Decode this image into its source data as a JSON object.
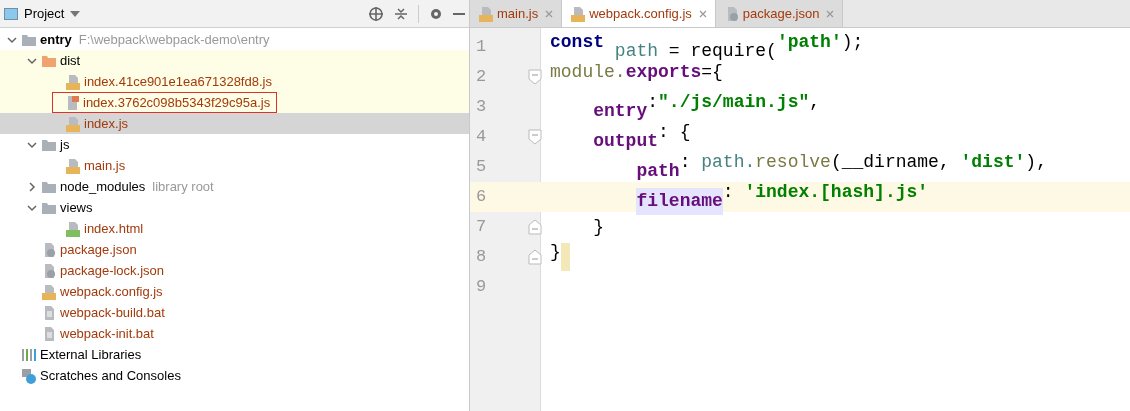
{
  "project_panel": {
    "title": "Project",
    "tree": [
      {
        "label": "entry",
        "hint": "F:\\webpack\\webpack-demo\\entry",
        "kind": "folder",
        "bold": true,
        "expanded": true,
        "selected": false,
        "children": [
          {
            "label": "dist",
            "kind": "excluded-folder",
            "expanded": true,
            "selected": false,
            "marked": true,
            "children": [
              {
                "label": "index.41ce901e1ea671328fd8.js",
                "kind": "js",
                "selected": false,
                "marked": true,
                "boxed": false
              },
              {
                "label": "index.3762c098b5343f29c95a.js",
                "kind": "binary",
                "selected": false,
                "marked": true,
                "boxed": true
              },
              {
                "label": "index.js",
                "kind": "js",
                "selected": true,
                "marked": true,
                "boxed": false
              }
            ]
          },
          {
            "label": "js",
            "kind": "folder",
            "expanded": true,
            "selected": false,
            "children": [
              {
                "label": "main.js",
                "kind": "js",
                "selected": false
              }
            ]
          },
          {
            "label": "node_modules",
            "hint": "library root",
            "kind": "folder",
            "expanded": false,
            "selected": false
          },
          {
            "label": "views",
            "kind": "folder",
            "expanded": true,
            "selected": false,
            "children": [
              {
                "label": "index.html",
                "kind": "html",
                "selected": false
              }
            ]
          },
          {
            "label": "package.json",
            "kind": "json",
            "selected": false
          },
          {
            "label": "package-lock.json",
            "kind": "json",
            "selected": false
          },
          {
            "label": "webpack.config.js",
            "kind": "js",
            "selected": false
          },
          {
            "label": "webpack-build.bat",
            "kind": "text",
            "selected": false
          },
          {
            "label": "webpack-init.bat",
            "kind": "text",
            "selected": false
          }
        ]
      },
      {
        "label": "External Libraries",
        "kind": "libraries",
        "selected": false
      },
      {
        "label": "Scratches and Consoles",
        "kind": "scratches",
        "selected": false
      }
    ]
  },
  "editor": {
    "tabs": [
      {
        "label": "main.js",
        "kind": "js",
        "selected": false
      },
      {
        "label": "webpack.config.js",
        "kind": "js",
        "selected": true
      },
      {
        "label": "package.json",
        "kind": "json",
        "selected": false
      }
    ],
    "lines": [
      {
        "number": "1",
        "current": false,
        "tokens": [
          {
            "kind": "keyword",
            "text": "const"
          },
          {
            "kind": "variable",
            "text": " path"
          },
          {
            "kind": "plain",
            "text": " = require("
          },
          {
            "kind": "string",
            "text": "'path'"
          },
          {
            "kind": "plain",
            "text": ");"
          }
        ]
      },
      {
        "number": "2",
        "current": false,
        "fold_start": true,
        "tokens": [
          {
            "kind": "global",
            "text": "module."
          },
          {
            "kind": "property",
            "text": "exports"
          },
          {
            "kind": "plain",
            "text": "={"
          }
        ]
      },
      {
        "number": "3",
        "current": false,
        "tokens": [
          {
            "kind": "property",
            "text": "    entry"
          },
          {
            "kind": "plain",
            "text": ":"
          },
          {
            "kind": "string",
            "text": "\"./js/main.js\""
          },
          {
            "kind": "plain",
            "text": ","
          }
        ]
      },
      {
        "number": "4",
        "current": false,
        "fold_start": true,
        "tokens": [
          {
            "kind": "property",
            "text": "    output"
          },
          {
            "kind": "plain",
            "text": ": {"
          }
        ]
      },
      {
        "number": "5",
        "current": false,
        "tokens": [
          {
            "kind": "property",
            "text": "        path"
          },
          {
            "kind": "plain",
            "text": ": "
          },
          {
            "kind": "variable",
            "text": "path."
          },
          {
            "kind": "global",
            "text": "resolve"
          },
          {
            "kind": "plain",
            "text": "(__dirname, "
          },
          {
            "kind": "string",
            "text": "'dist'"
          },
          {
            "kind": "plain",
            "text": "),"
          }
        ]
      },
      {
        "number": "6",
        "current": true,
        "tokens": [
          {
            "kind": "property-highlighted",
            "text": "        filename"
          },
          {
            "kind": "plain",
            "text": ": "
          },
          {
            "kind": "string",
            "text": "'index.[hash].js'"
          }
        ]
      },
      {
        "number": "7",
        "current": false,
        "fold_end": true,
        "tokens": [
          {
            "kind": "plain",
            "text": "    }"
          }
        ]
      },
      {
        "number": "8",
        "current": false,
        "fold_end": true,
        "brace_match": true,
        "tokens": [
          {
            "kind": "plain",
            "text": "}"
          }
        ]
      },
      {
        "number": "9",
        "current": false
      }
    ]
  }
}
